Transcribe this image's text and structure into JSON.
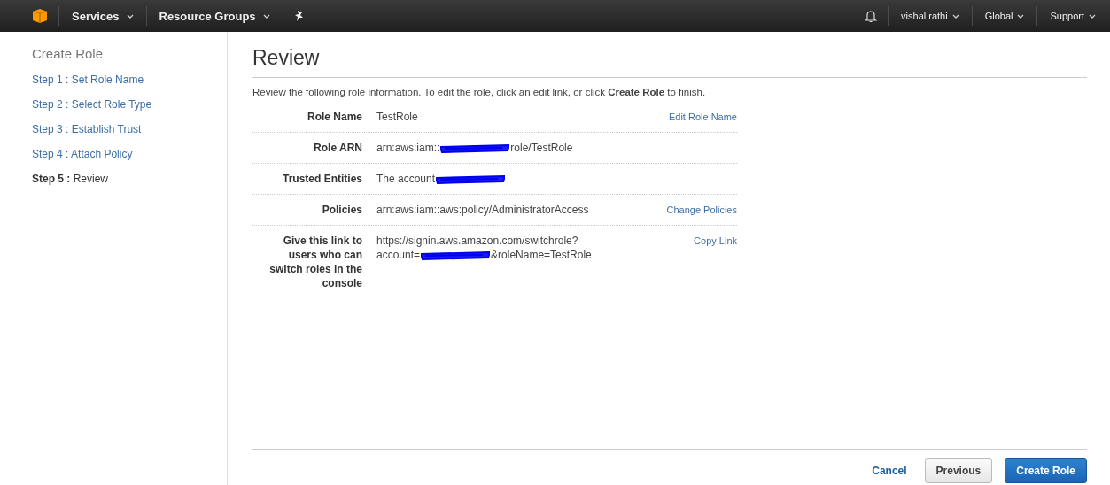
{
  "top_nav": {
    "left": [
      {
        "label": "Services",
        "dropdown": true
      },
      {
        "label": "Resource Groups",
        "dropdown": true
      }
    ],
    "right": [
      {
        "label": "vishal rathi",
        "dropdown": true
      },
      {
        "label": "Global",
        "dropdown": true
      },
      {
        "label": "Support",
        "dropdown": true
      }
    ]
  },
  "sidebar": {
    "title": "Create Role",
    "steps": [
      {
        "label": "Step 1 :",
        "name": "Set Role Name",
        "selected": false
      },
      {
        "label": "Step 2 :",
        "name": "Select Role Type",
        "selected": false
      },
      {
        "label": "Step 3 :",
        "name": "Establish Trust",
        "selected": false
      },
      {
        "label": "Step 4 :",
        "name": "Attach Policy",
        "selected": false
      },
      {
        "label": "Step 5 :",
        "name": "Review",
        "selected": true
      }
    ]
  },
  "main": {
    "title": "Review",
    "intro": "Review the following role information. To edit the role, click an edit link, or click **Create Role** to finish.",
    "rows": [
      {
        "label": "Role Name",
        "parts": [
          {
            "kind": "text",
            "text": "TestRole"
          }
        ],
        "action": "Edit Role Name"
      },
      {
        "label": "Role ARN",
        "parts": [
          {
            "kind": "text",
            "text": "arn:aws:iam::"
          },
          {
            "kind": "redaction"
          },
          {
            "kind": "text",
            "text": "role/TestRole"
          }
        ]
      },
      {
        "label": "Trusted Entities",
        "parts": [
          {
            "kind": "text",
            "text": "The account"
          },
          {
            "kind": "redaction"
          }
        ]
      },
      {
        "label": "Policies",
        "parts": [
          {
            "kind": "text",
            "text": "arn:aws:iam::aws:policy/AdministratorAccess"
          }
        ],
        "action": "Change Policies"
      },
      {
        "label": "Give this link to users who can switch roles in the console",
        "parts": [
          {
            "kind": "text",
            "text": "https://signin.aws.amazon.com/switchrole?"
          },
          {
            "kind": "break"
          },
          {
            "kind": "text",
            "text": "account="
          },
          {
            "kind": "redaction"
          },
          {
            "kind": "text",
            "text": "&roleName=TestRole"
          }
        ],
        "action": "Copy Link"
      }
    ]
  },
  "footer": {
    "cancel": "Cancel",
    "previous": "Previous",
    "primary": "Create Role"
  }
}
